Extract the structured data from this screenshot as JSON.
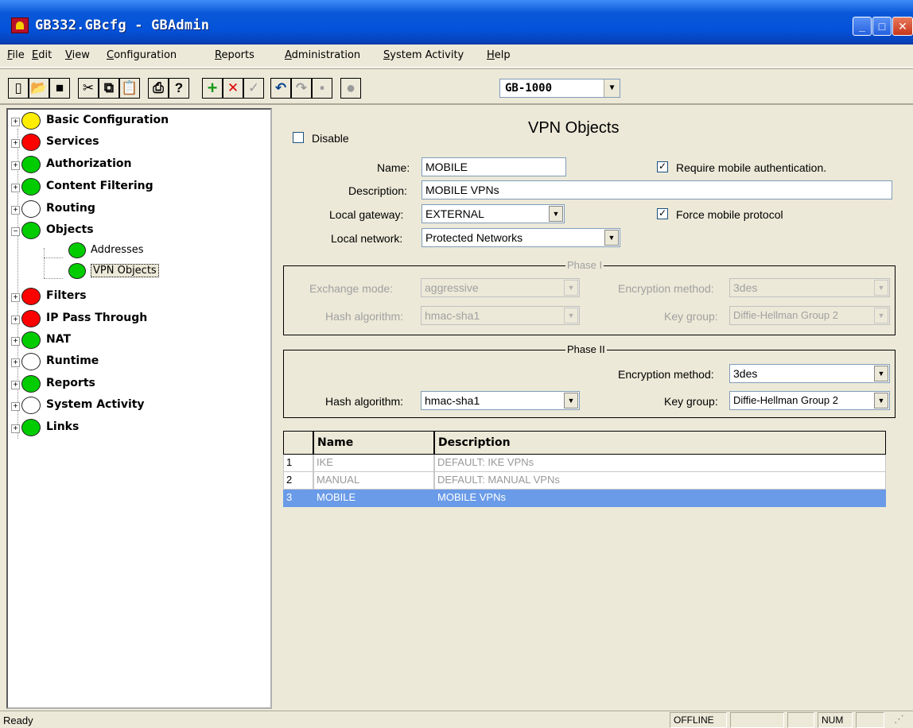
{
  "window": {
    "title": "GB332.GBcfg - GBAdmin"
  },
  "menu": [
    {
      "u": "F",
      "rest": "ile"
    },
    {
      "u": "E",
      "rest": "dit"
    },
    {
      "u": "V",
      "rest": "iew"
    },
    {
      "u": "C",
      "rest": "onfiguration"
    },
    {
      "u": "R",
      "rest": "eports"
    },
    {
      "u": "A",
      "rest": "dministration"
    },
    {
      "u": "S",
      "rest": "ystem Activity"
    },
    {
      "u": "H",
      "rest": "elp"
    }
  ],
  "toolbar": {
    "device": "GB-1000",
    "icons": [
      "new-icon",
      "open-icon",
      "save-all-icon",
      "cut-icon",
      "copy-icon",
      "paste-icon",
      "print-icon",
      "help-icon",
      "add-icon",
      "delete-icon",
      "check-icon",
      "undo-icon",
      "redo-icon",
      "save-icon",
      "record-icon"
    ]
  },
  "tree": [
    {
      "label": "Basic Configuration",
      "color": "#ffee00",
      "expand": "+"
    },
    {
      "label": "Services",
      "color": "#ff0000",
      "expand": "+"
    },
    {
      "label": "Authorization",
      "color": "#00cc00",
      "expand": "+"
    },
    {
      "label": "Content Filtering",
      "color": "#00cc00",
      "expand": "+"
    },
    {
      "label": "Routing",
      "color": "#ffffff",
      "expand": "+"
    },
    {
      "label": "Objects",
      "color": "#00cc00",
      "expand": "−"
    },
    {
      "label": "Addresses",
      "color": "#00cc00",
      "child": true
    },
    {
      "label": "VPN Objects",
      "color": "#00cc00",
      "child": true,
      "selected": true
    },
    {
      "label": "Filters",
      "color": "#ff0000",
      "expand": "+"
    },
    {
      "label": "IP Pass Through",
      "color": "#ff0000",
      "expand": "+"
    },
    {
      "label": "NAT",
      "color": "#00cc00",
      "expand": "+"
    },
    {
      "label": "Runtime",
      "color": "#ffffff",
      "expand": "+"
    },
    {
      "label": "Reports",
      "color": "#00cc00",
      "expand": "+"
    },
    {
      "label": "System Activity",
      "color": "#ffffff",
      "expand": "+"
    },
    {
      "label": "Links",
      "color": "#00cc00",
      "expand": "+"
    }
  ],
  "form": {
    "heading": "VPN Objects",
    "disable_label": "Disable",
    "name_label": "Name:",
    "name_value": "MOBILE",
    "require_mobile_auth": "Require mobile authentication.",
    "description_label": "Description:",
    "description_value": "MOBILE VPNs",
    "local_gateway_label": "Local gateway:",
    "local_gateway_value": "EXTERNAL",
    "force_mobile_protocol": "Force mobile protocol",
    "local_network_label": "Local network:",
    "local_network_value": "Protected Networks"
  },
  "phase1": {
    "title": "Phase I",
    "exchange_mode_label": "Exchange mode:",
    "exchange_mode_value": "aggressive",
    "encryption_label": "Encryption method:",
    "encryption_value": "3des",
    "hash_label": "Hash algorithm:",
    "hash_value": "hmac-sha1",
    "keygroup_label": "Key group:",
    "keygroup_value": "Diffie-Hellman Group 2"
  },
  "phase2": {
    "title": "Phase II",
    "encryption_label": "Encryption method:",
    "encryption_value": "3des",
    "hash_label": "Hash algorithm:",
    "hash_value": "hmac-sha1",
    "keygroup_label": "Key group:",
    "keygroup_value": "Diffie-Hellman Group 2"
  },
  "grid": {
    "columns": [
      "Name",
      "Description"
    ],
    "rows": [
      {
        "num": "1",
        "name": "IKE",
        "desc": "DEFAULT: IKE VPNs"
      },
      {
        "num": "2",
        "name": "MANUAL",
        "desc": "DEFAULT: MANUAL VPNs"
      },
      {
        "num": "3",
        "name": "MOBILE",
        "desc": "MOBILE VPNs",
        "selected": true
      }
    ]
  },
  "status": {
    "text": "Ready",
    "offline": "OFFLINE",
    "num": "NUM"
  }
}
